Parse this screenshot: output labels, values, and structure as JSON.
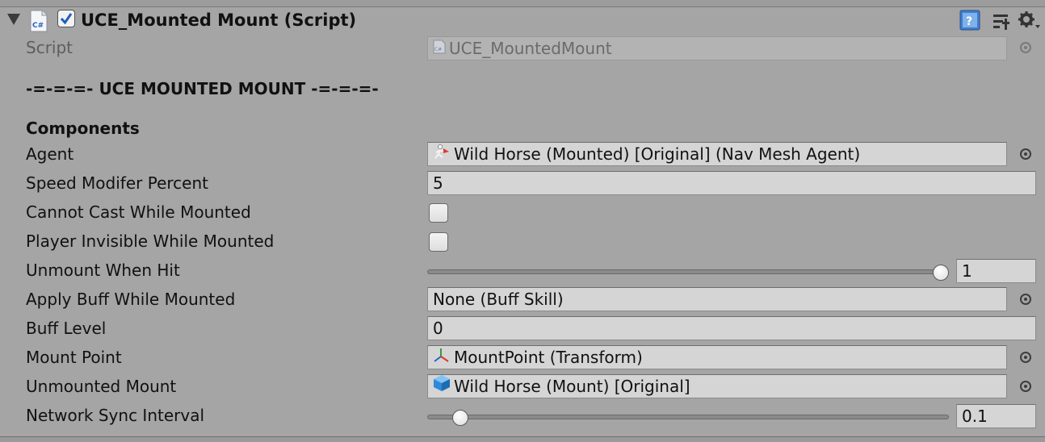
{
  "header": {
    "title": "UCE_Mounted Mount (Script)",
    "enabled": true,
    "icons": [
      "help-book-icon",
      "preset-sliders-icon",
      "gear-menu-icon"
    ]
  },
  "script_row": {
    "label": "Script",
    "value": "UCE_MountedMount",
    "icon": "csharp-script-icon"
  },
  "section_heading": "-=-=-=- UCE MOUNTED MOUNT -=-=-=-",
  "components_heading": "Components",
  "fields": {
    "agent": {
      "label": "Agent",
      "value": "Wild Horse (Mounted) [Original] (Nav Mesh Agent)",
      "icon": "nav-mesh-agent-icon"
    },
    "speed_modifier": {
      "label": "Speed Modifer Percent",
      "value": "5"
    },
    "cannot_cast": {
      "label": "Cannot Cast While Mounted",
      "checked": false
    },
    "player_invisible": {
      "label": "Player Invisible While Mounted",
      "checked": false
    },
    "unmount_when_hit": {
      "label": "Unmount When Hit",
      "value": "1",
      "slider_fraction": 1.0
    },
    "apply_buff": {
      "label": "Apply Buff While Mounted",
      "value": "None (Buff Skill)"
    },
    "buff_level": {
      "label": "Buff Level",
      "value": "0"
    },
    "mount_point": {
      "label": "Mount Point",
      "value": "MountPoint (Transform)",
      "icon": "transform-axes-icon"
    },
    "unmounted_mount": {
      "label": "Unmounted Mount",
      "value": "Wild Horse (Mount) [Original]",
      "icon": "prefab-cube-icon"
    },
    "network_sync": {
      "label": "Network Sync Interval",
      "value": "0.1",
      "slider_fraction": 0.05
    }
  },
  "colors": {
    "panel_bg": "#a5a5a5",
    "field_bg": "#d5d5d5",
    "toggle_check": "#1f5fb8"
  }
}
